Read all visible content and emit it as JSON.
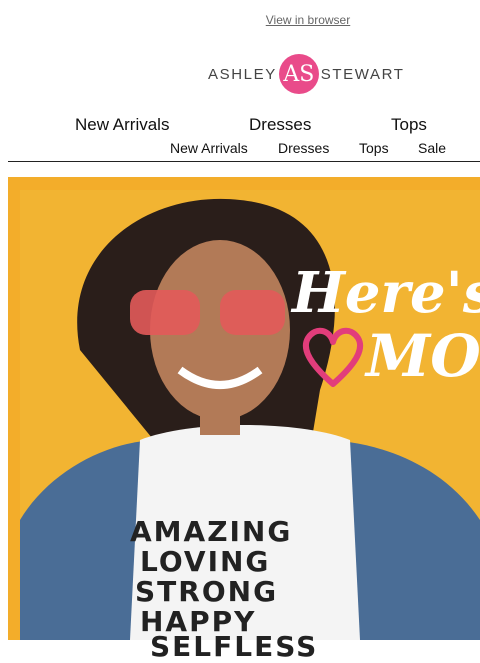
{
  "header": {
    "view_in_browser": "View in browser"
  },
  "brand": {
    "logo_left": "ASHLEY",
    "logo_mark": "AS",
    "logo_right": "STEWART",
    "accent": "#e94b8a"
  },
  "nav_primary": [
    "New Arrivals",
    "Dresses",
    "Tops"
  ],
  "nav_secondary": [
    "New Arrivals",
    "Dresses",
    "Tops",
    "Sale"
  ],
  "hero": {
    "headline_line1": "Here's",
    "headline_line2": "MO",
    "background": "#f3ad2a",
    "shirt_words": [
      "AMAZING",
      "LOVING",
      "STRONG",
      "HAPPY",
      "SELFLESS"
    ]
  }
}
